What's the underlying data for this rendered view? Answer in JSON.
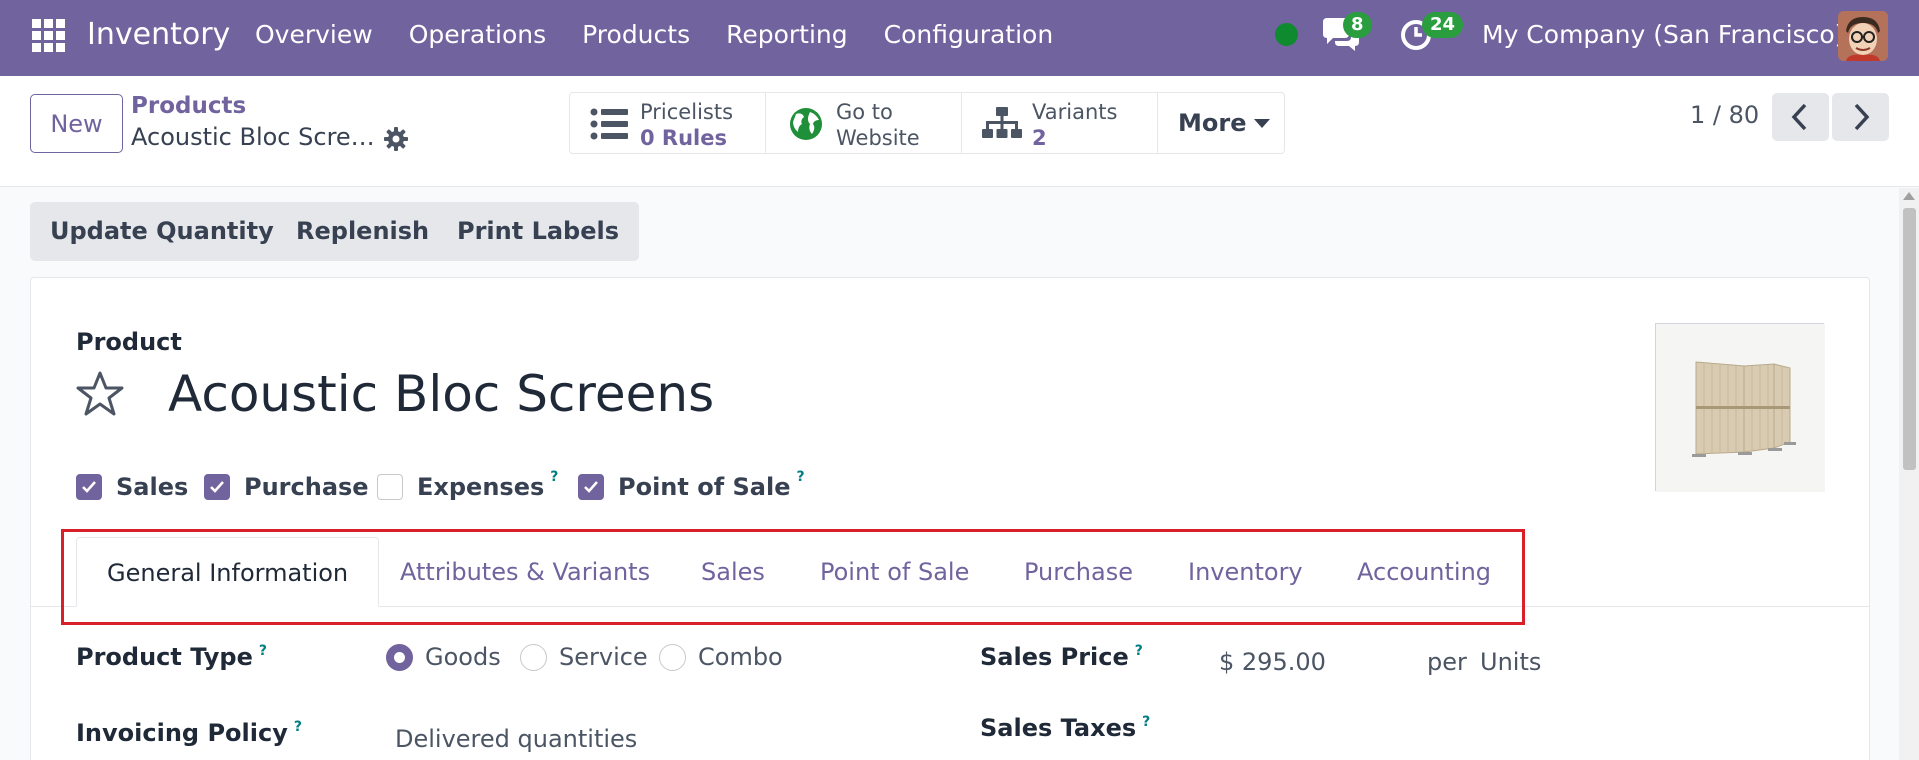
{
  "navbar": {
    "app_name": "Inventory",
    "menu": [
      "Overview",
      "Operations",
      "Products",
      "Reporting",
      "Configuration"
    ],
    "messages_count": "8",
    "activities_count": "24",
    "company": "My Company (San Francisco)"
  },
  "control": {
    "new_label": "New",
    "breadcrumb_parent": "Products",
    "breadcrumb_current": "Acoustic Bloc Screens",
    "smart_buttons": [
      {
        "label": "Pricelists",
        "value": "0  Rules",
        "icon": "list-icon"
      },
      {
        "label": "Go to",
        "value": "Website",
        "icon": "globe-icon"
      },
      {
        "label": "Variants",
        "value": "2",
        "icon": "sitemap-icon"
      }
    ],
    "more_label": "More",
    "pager": "1 / 80"
  },
  "actions": [
    "Update Quantity",
    "Replenish",
    "Print Labels"
  ],
  "form": {
    "section_label": "Product",
    "product_name": "Acoustic Bloc Screens",
    "checkboxes": [
      {
        "label": "Sales",
        "checked": true,
        "help": false
      },
      {
        "label": "Purchase",
        "checked": true,
        "help": false
      },
      {
        "label": "Expenses",
        "checked": false,
        "help": true
      },
      {
        "label": "Point of Sale",
        "checked": true,
        "help": true
      }
    ],
    "help_mark": "?",
    "tabs": [
      "General Information",
      "Attributes & Variants",
      "Sales",
      "Point of Sale",
      "Purchase",
      "Inventory",
      "Accounting"
    ],
    "active_tab": "General Information",
    "product_type_label": "Product Type",
    "product_type_options": [
      "Goods",
      "Service",
      "Combo"
    ],
    "product_type_selected": "Goods",
    "invoicing_policy_label": "Invoicing Policy",
    "invoicing_policy_value": "Delivered quantities",
    "sales_price_label": "Sales Price",
    "sales_price_value": "$ 295.00",
    "sales_price_per": "per",
    "sales_price_unit": "Units",
    "sales_taxes_label": "Sales Taxes"
  },
  "colors": {
    "brand": "#71639e",
    "badge": "#2a9d3f",
    "online": "#0f8a2e",
    "highlight": "#d91f2a"
  }
}
